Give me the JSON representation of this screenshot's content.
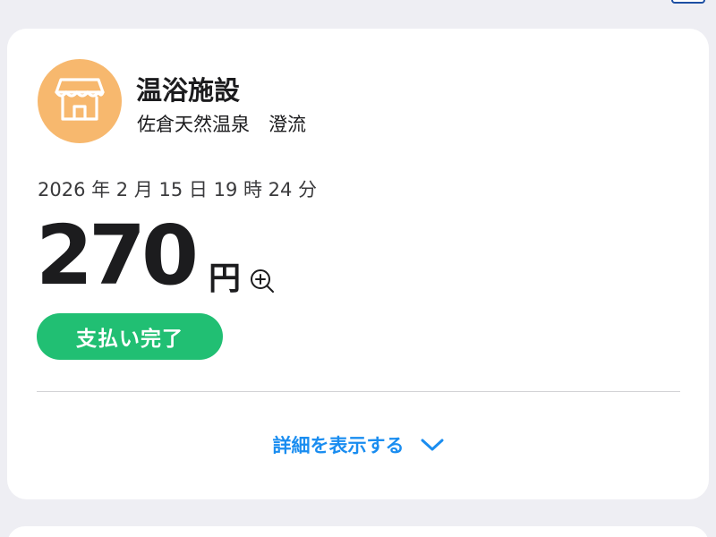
{
  "merchant": {
    "category": "温浴施設",
    "name": "佐倉天然温泉　澄流",
    "icon": "shop-icon",
    "icon_bg": "#f7b86e"
  },
  "transaction": {
    "datetime": "2026 年 2 月 15 日 19 時 24 分",
    "amount": "270",
    "currency": "円",
    "status": "支払い完了",
    "status_color": "#21bf73"
  },
  "details_toggle": {
    "label": "詳細を表示する",
    "icon": "chevron-down-icon",
    "color": "#1a8df0"
  }
}
